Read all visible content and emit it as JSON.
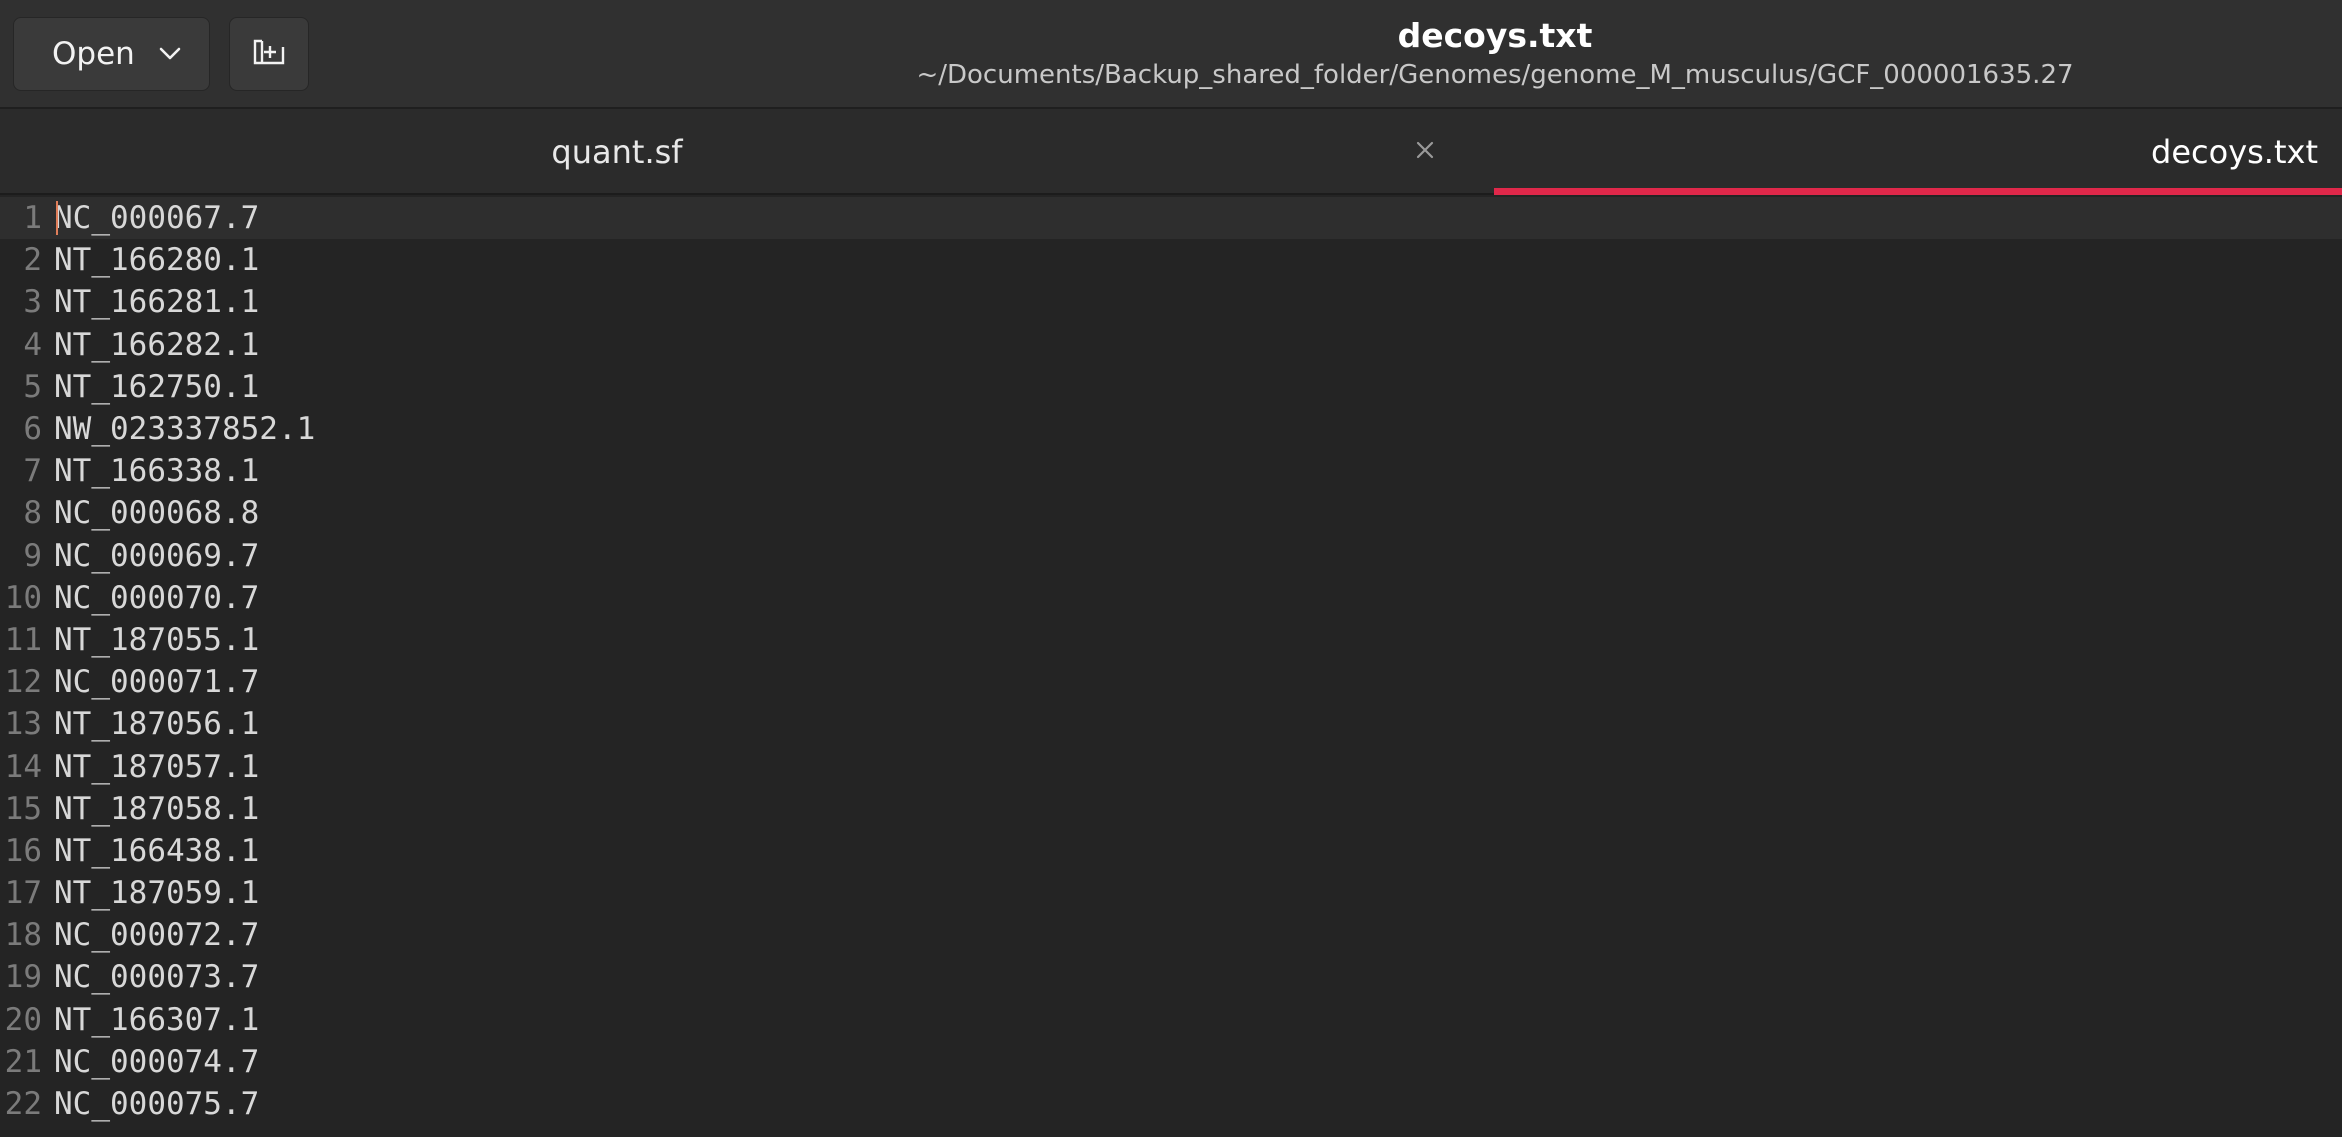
{
  "header": {
    "open_label": "Open",
    "title": "decoys.txt",
    "subtitle": "~/Documents/Backup_shared_folder/Genomes/genome_M_musculus/GCF_000001635.27"
  },
  "tabs": [
    {
      "label": "quant.sf",
      "active": false
    },
    {
      "label": "decoys.txt",
      "active": true
    }
  ],
  "colors": {
    "accent": "#e0284a",
    "background": "#242424",
    "header": "#303030"
  },
  "editor": {
    "current_line": 1,
    "lines": [
      {
        "number": "1",
        "text": "NC_000067.7"
      },
      {
        "number": "2",
        "text": "NT_166280.1"
      },
      {
        "number": "3",
        "text": "NT_166281.1"
      },
      {
        "number": "4",
        "text": "NT_166282.1"
      },
      {
        "number": "5",
        "text": "NT_162750.1"
      },
      {
        "number": "6",
        "text": "NW_023337852.1"
      },
      {
        "number": "7",
        "text": "NT_166338.1"
      },
      {
        "number": "8",
        "text": "NC_000068.8"
      },
      {
        "number": "9",
        "text": "NC_000069.7"
      },
      {
        "number": "10",
        "text": "NC_000070.7"
      },
      {
        "number": "11",
        "text": "NT_187055.1"
      },
      {
        "number": "12",
        "text": "NC_000071.7"
      },
      {
        "number": "13",
        "text": "NT_187056.1"
      },
      {
        "number": "14",
        "text": "NT_187057.1"
      },
      {
        "number": "15",
        "text": "NT_187058.1"
      },
      {
        "number": "16",
        "text": "NT_166438.1"
      },
      {
        "number": "17",
        "text": "NT_187059.1"
      },
      {
        "number": "18",
        "text": "NC_000072.7"
      },
      {
        "number": "19",
        "text": "NC_000073.7"
      },
      {
        "number": "20",
        "text": "NT_166307.1"
      },
      {
        "number": "21",
        "text": "NC_000074.7"
      },
      {
        "number": "22",
        "text": "NC_000075.7"
      }
    ]
  }
}
